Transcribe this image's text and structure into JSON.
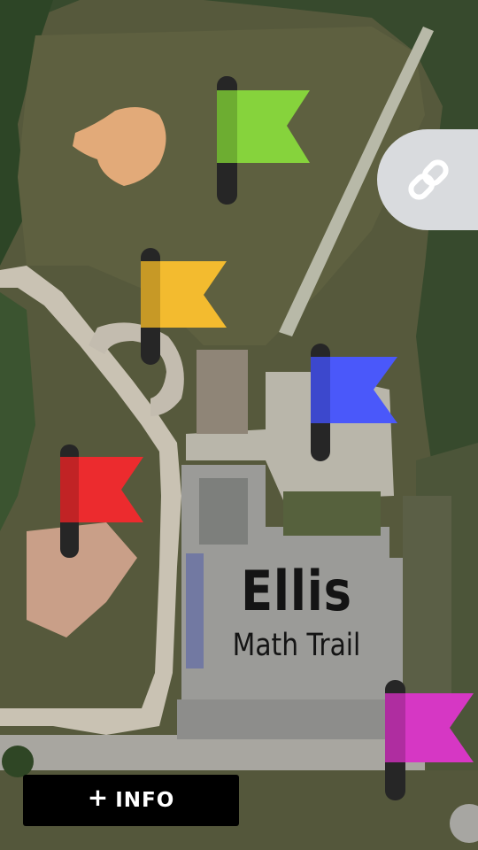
{
  "title": {
    "main": "Ellis",
    "sub": "Math Trail"
  },
  "info_button": {
    "plus": "+",
    "label": "INFO"
  },
  "link_button": {
    "icon": "link-icon"
  },
  "flags": [
    {
      "name": "flag-green",
      "color": "#86d33c"
    },
    {
      "name": "flag-yellow",
      "color": "#f3bb2f"
    },
    {
      "name": "flag-blue",
      "color": "#4a58fa"
    },
    {
      "name": "flag-red",
      "color": "#ec2b2e"
    },
    {
      "name": "flag-magenta",
      "color": "#d637c4"
    }
  ],
  "map_colors": {
    "grass": "#55573a",
    "forest": "#2f4a24",
    "infield": "#e2aa79",
    "path": "#c9c2b3",
    "roof": "#9a9a9a",
    "lot": "#a7a8a3"
  }
}
